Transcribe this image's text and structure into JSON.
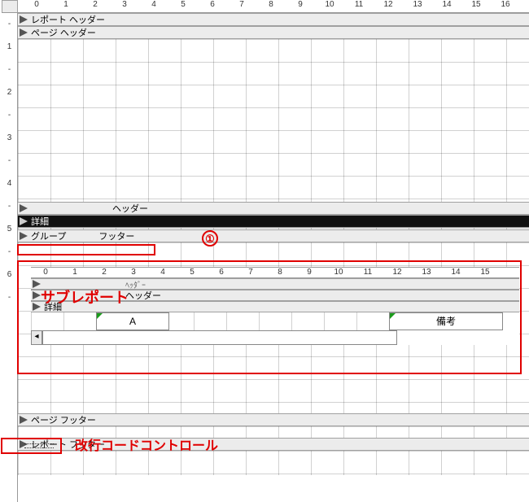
{
  "ruler_main": [
    "0",
    "1",
    "2",
    "3",
    "4",
    "5",
    "6",
    "7",
    "8",
    "9",
    "10",
    "11",
    "12",
    "13",
    "14",
    "15",
    "16"
  ],
  "ruler_sub": [
    "0",
    "1",
    "2",
    "3",
    "4",
    "5",
    "6",
    "7",
    "8",
    "9",
    "10",
    "11",
    "12",
    "13",
    "14",
    "15"
  ],
  "vruler": [
    "-",
    "1",
    "-",
    "2",
    "-",
    "3",
    "-",
    "4",
    "-",
    "5",
    "-",
    "6",
    "-"
  ],
  "sections": {
    "report_header": "レポート ヘッダー",
    "page_header": "ページ ヘッダー",
    "group_header": "ヘッダー",
    "detail": "詳細",
    "group_footer_pre": "グループ",
    "group_footer_suf": "フッター",
    "page_footer": "ページ フッター",
    "report_footer": "レポート フッター"
  },
  "annotations": {
    "sub_report_label": "サブレポート",
    "circled_number": "①",
    "newline_control": "改行コードコントロール",
    "sub_group_header": "ヘッダー",
    "sub_detail": "詳細"
  },
  "subreport_columns": {
    "col_a": "A",
    "col_rem": "備考"
  }
}
